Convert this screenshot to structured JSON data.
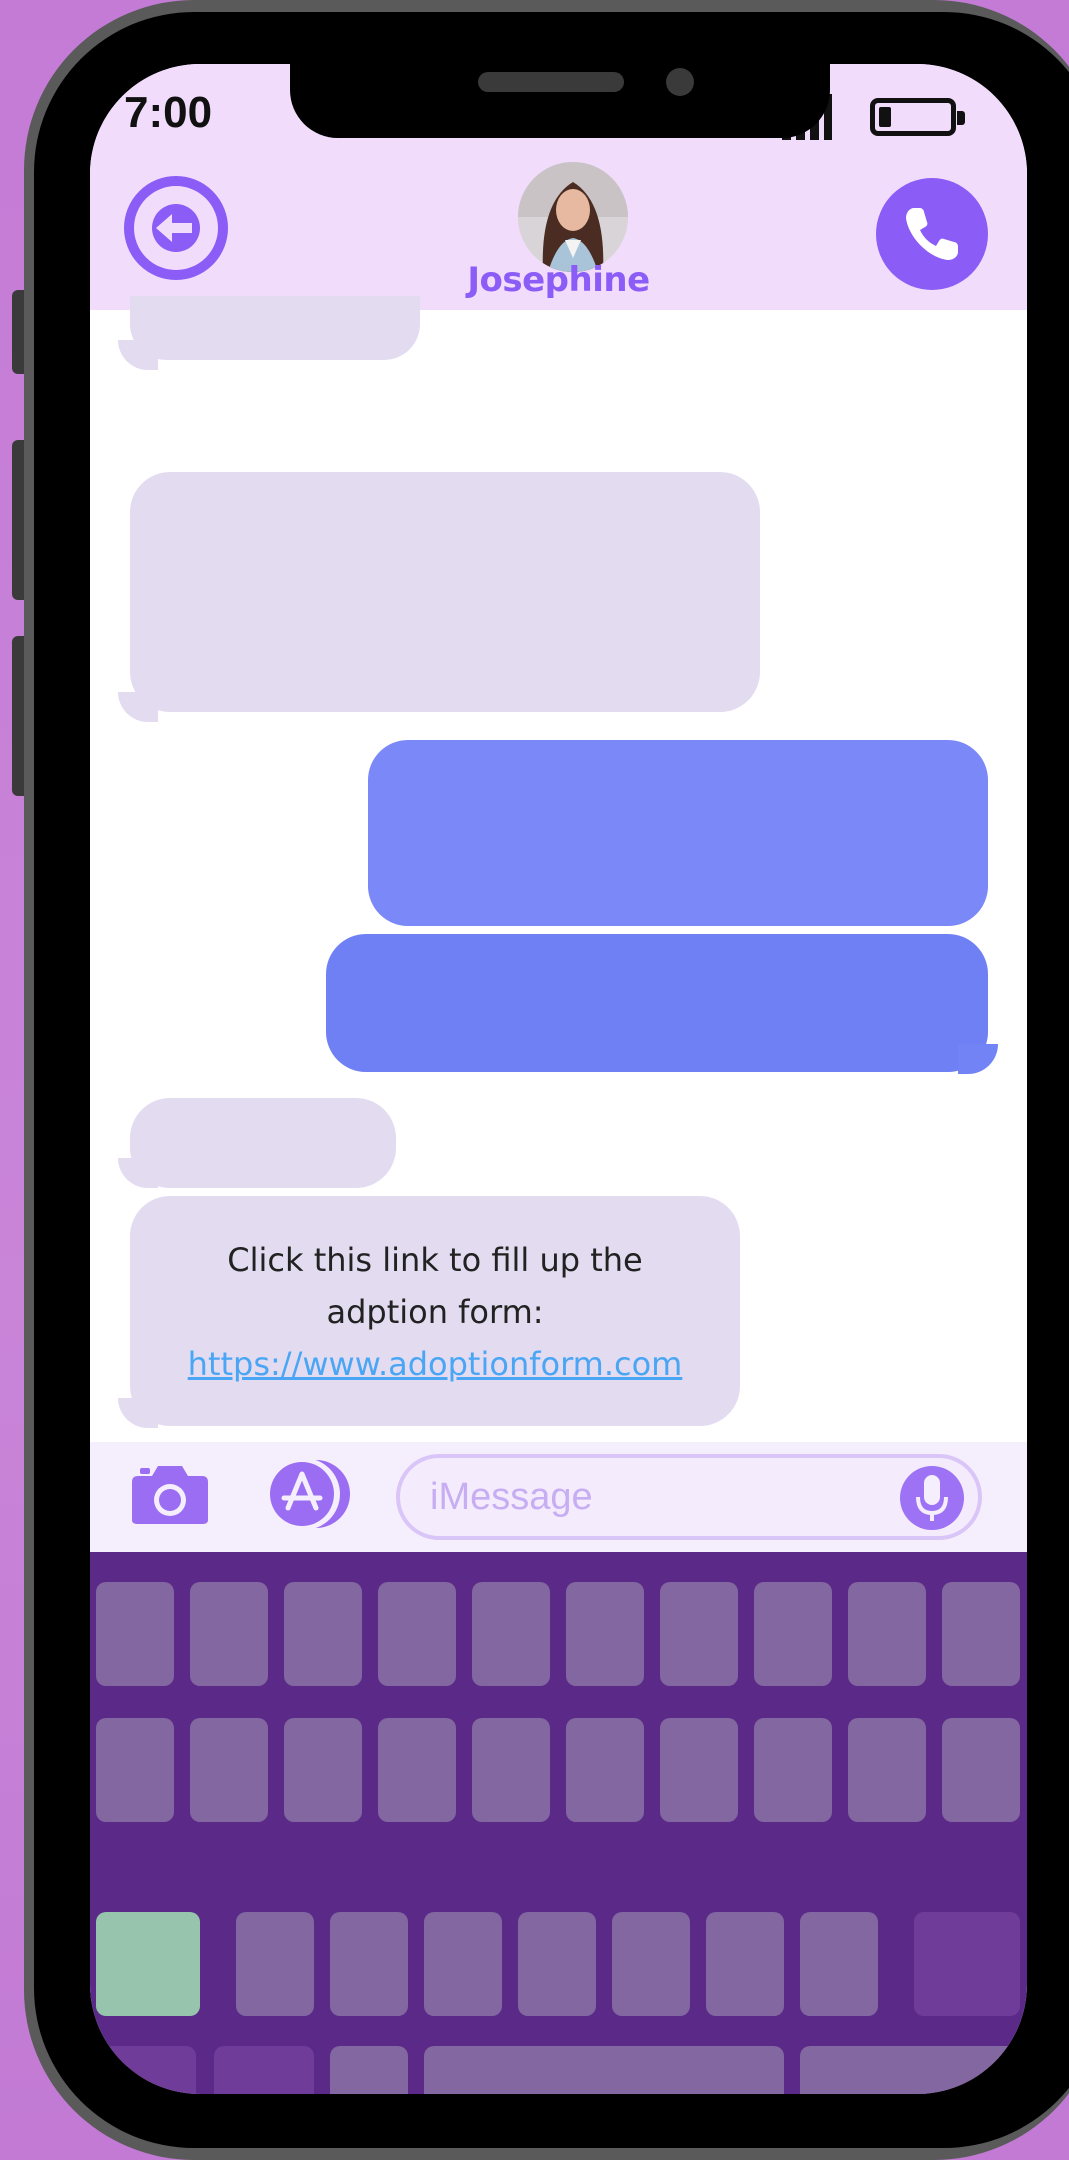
{
  "status_bar": {
    "time": "7:00"
  },
  "header": {
    "contact_name": "Josephine"
  },
  "messages": [
    {
      "direction": "incoming",
      "text": ""
    },
    {
      "direction": "incoming",
      "text": ""
    },
    {
      "direction": "outgoing",
      "text": ""
    },
    {
      "direction": "outgoing",
      "text": ""
    },
    {
      "direction": "incoming",
      "text": ""
    },
    {
      "direction": "incoming",
      "text_line1": "Click this link to fill up the",
      "text_line2": "adption form:",
      "link": "https://www.adoptionform.com"
    }
  ],
  "compose": {
    "placeholder": "iMessage"
  },
  "icons": [
    "back-arrow-icon",
    "phone-icon",
    "camera-icon",
    "app-store-icon",
    "microphone-icon",
    "signal-icon",
    "battery-icon"
  ],
  "colors": {
    "accent": "#8b5cf6",
    "header_bg": "#f1dcfc",
    "incoming_bubble": "#e3dcf1",
    "outgoing_bubble": "#7a88f8",
    "keyboard_bg": "#5b2a88",
    "key": "#8267a0",
    "highlight_key": "#96c4ad",
    "link": "#4aa6f5"
  }
}
